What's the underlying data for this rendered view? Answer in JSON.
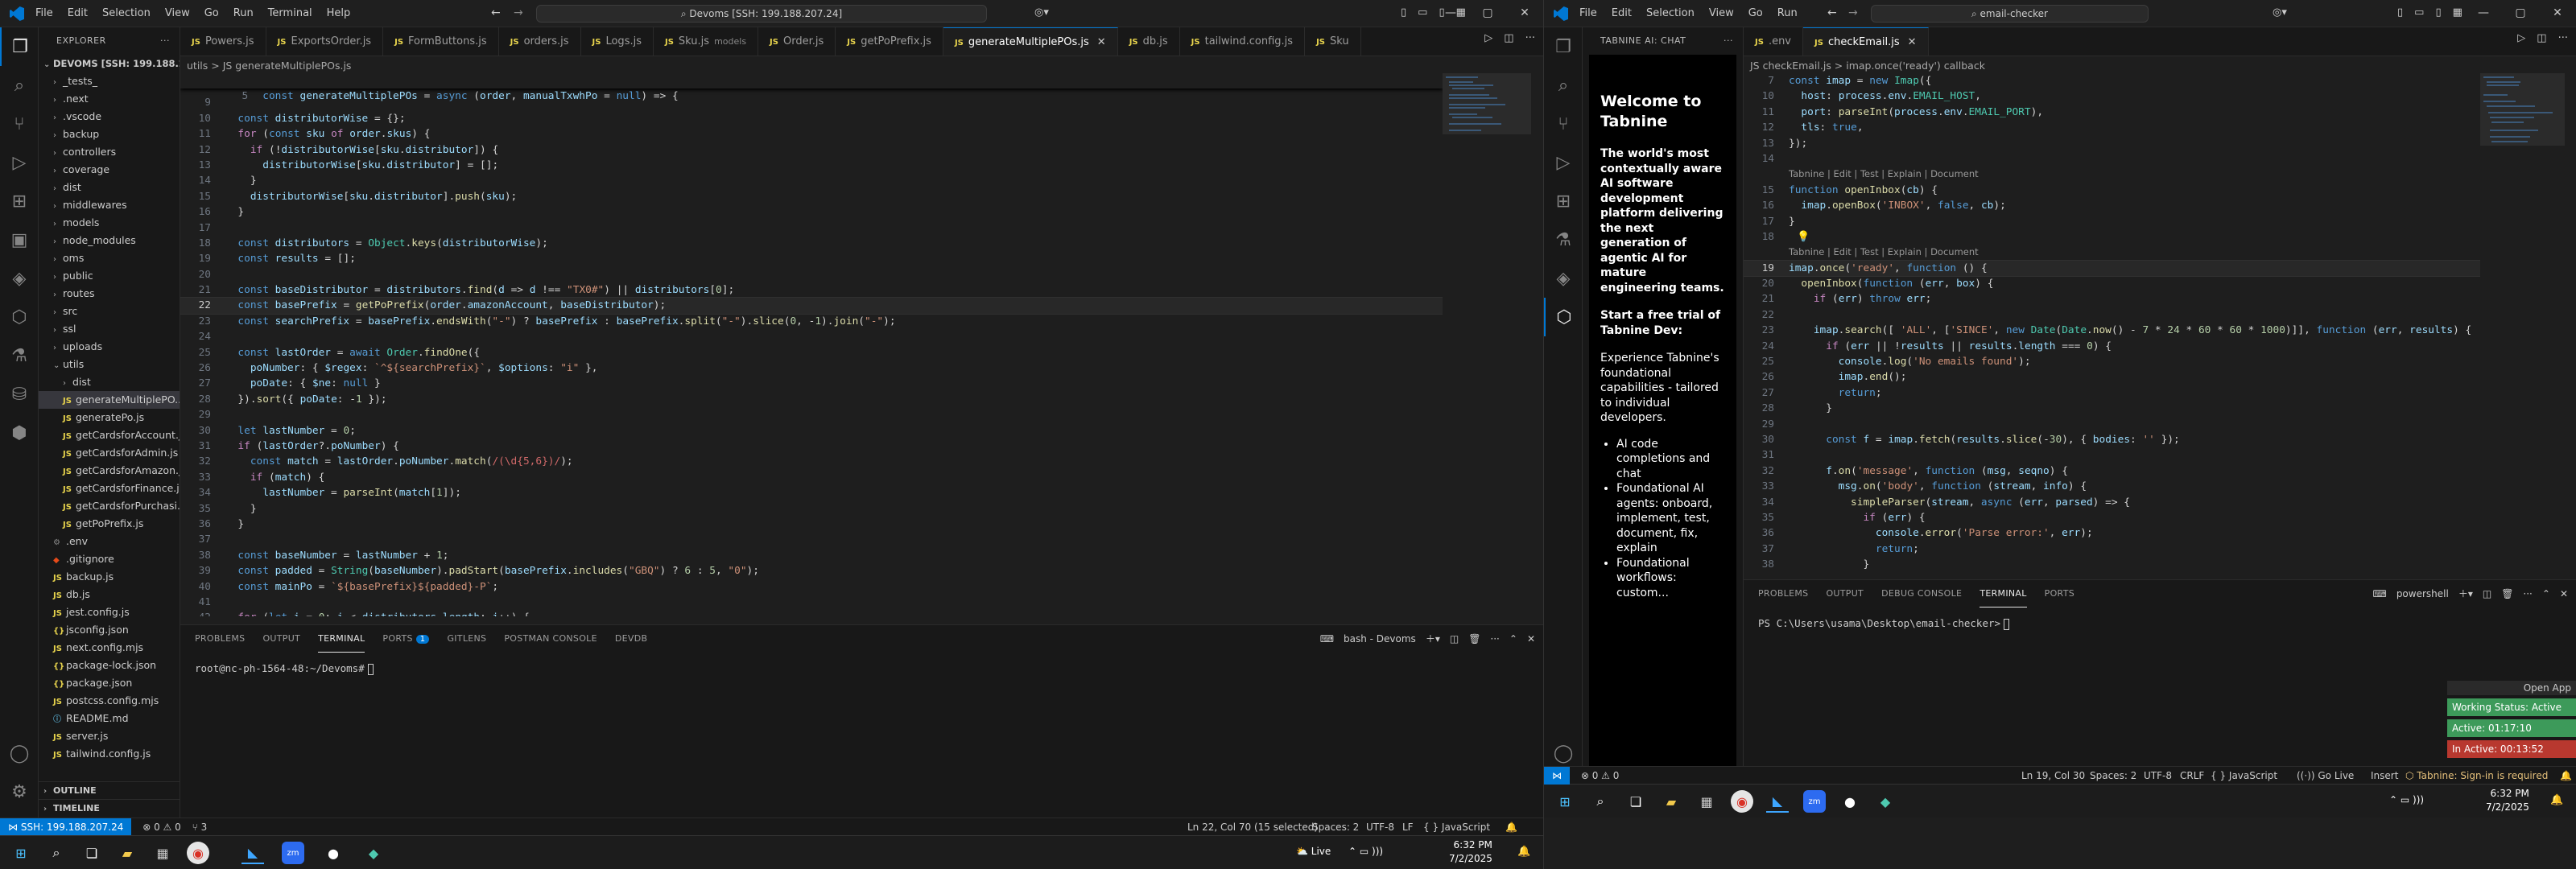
{
  "left_window": {
    "menu": [
      "File",
      "Edit",
      "Selection",
      "View",
      "Go",
      "Run",
      "Terminal",
      "Help"
    ],
    "search": "Devoms [SSH: 199.188.207.24]",
    "explorer_title": "EXPLORER",
    "root_folder": "DEVOMS [SSH: 199.188.20...",
    "tree": [
      {
        "label": "_tests_",
        "kind": "folder",
        "depth": 1
      },
      {
        "label": ".next",
        "kind": "folder",
        "depth": 1
      },
      {
        "label": ".vscode",
        "kind": "folder",
        "depth": 1
      },
      {
        "label": "backup",
        "kind": "folder",
        "depth": 1
      },
      {
        "label": "controllers",
        "kind": "folder",
        "depth": 1
      },
      {
        "label": "coverage",
        "kind": "folder",
        "depth": 1
      },
      {
        "label": "dist",
        "kind": "folder",
        "depth": 1
      },
      {
        "label": "middlewares",
        "kind": "folder",
        "depth": 1
      },
      {
        "label": "models",
        "kind": "folder",
        "depth": 1
      },
      {
        "label": "node_modules",
        "kind": "folder",
        "depth": 1
      },
      {
        "label": "oms",
        "kind": "folder",
        "depth": 1
      },
      {
        "label": "public",
        "kind": "folder",
        "depth": 1
      },
      {
        "label": "routes",
        "kind": "folder",
        "depth": 1
      },
      {
        "label": "src",
        "kind": "folder",
        "depth": 1
      },
      {
        "label": "ssl",
        "kind": "folder",
        "depth": 1
      },
      {
        "label": "uploads",
        "kind": "folder",
        "depth": 1
      },
      {
        "label": "utils",
        "kind": "folder-open",
        "depth": 1
      },
      {
        "label": "dist",
        "kind": "folder",
        "depth": 2
      },
      {
        "label": "generateMultiplePO...",
        "kind": "js",
        "depth": 2,
        "selected": true
      },
      {
        "label": "generatePo.js",
        "kind": "js",
        "depth": 2
      },
      {
        "label": "getCardsforAccount.js",
        "kind": "js",
        "depth": 2
      },
      {
        "label": "getCardsforAdmin.js",
        "kind": "js",
        "depth": 2
      },
      {
        "label": "getCardsforAmazon.js",
        "kind": "js",
        "depth": 2
      },
      {
        "label": "getCardsforFinance.js",
        "kind": "js",
        "depth": 2
      },
      {
        "label": "getCardsforPurchasi...",
        "kind": "js",
        "depth": 2
      },
      {
        "label": "getPoPrefix.js",
        "kind": "js",
        "depth": 2
      },
      {
        "label": ".env",
        "kind": "env",
        "depth": 1
      },
      {
        "label": ".gitignore",
        "kind": "git",
        "depth": 1
      },
      {
        "label": "backup.js",
        "kind": "js",
        "depth": 1
      },
      {
        "label": "db.js",
        "kind": "js",
        "depth": 1
      },
      {
        "label": "jest.config.js",
        "kind": "js",
        "depth": 1
      },
      {
        "label": "jsconfig.json",
        "kind": "json",
        "depth": 1
      },
      {
        "label": "next.config.mjs",
        "kind": "js",
        "depth": 1
      },
      {
        "label": "package-lock.json",
        "kind": "json",
        "depth": 1
      },
      {
        "label": "package.json",
        "kind": "json",
        "depth": 1
      },
      {
        "label": "postcss.config.mjs",
        "kind": "js",
        "depth": 1
      },
      {
        "label": "README.md",
        "kind": "md",
        "depth": 1
      },
      {
        "label": "server.js",
        "kind": "js",
        "depth": 1
      },
      {
        "label": "tailwind.config.js",
        "kind": "js",
        "depth": 1
      }
    ],
    "outline": "OUTLINE",
    "timeline": "TIMELINE",
    "tabs": [
      {
        "label": "Powers.js"
      },
      {
        "label": "ExportsOrder.js"
      },
      {
        "label": "FormButtons.js"
      },
      {
        "label": "orders.js"
      },
      {
        "label": "Logs.js"
      },
      {
        "label": "Sku.js",
        "sub": "models"
      },
      {
        "label": "Order.js"
      },
      {
        "label": "getPoPrefix.js"
      },
      {
        "label": "generateMultiplePOs.js",
        "active": true
      },
      {
        "label": "db.js"
      },
      {
        "label": "tailwind.config.js"
      },
      {
        "label": "Sku"
      }
    ],
    "breadcrumb": "utils > JS generateMultiplePOs.js",
    "sticky_line": {
      "num": "5",
      "code": "const generateMultiplePOs = async (order, manualTxwhPo = null) => {"
    },
    "code": [
      {
        "num": "9",
        "code": ""
      },
      {
        "num": "10",
        "code": "  const distributorWise = {};"
      },
      {
        "num": "11",
        "code": "  for (const sku of order.skus) {"
      },
      {
        "num": "12",
        "code": "    if (!distributorWise[sku.distributor]) {"
      },
      {
        "num": "13",
        "code": "      distributorWise[sku.distributor] = [];"
      },
      {
        "num": "14",
        "code": "    }"
      },
      {
        "num": "15",
        "code": "    distributorWise[sku.distributor].push(sku);"
      },
      {
        "num": "16",
        "code": "  }"
      },
      {
        "num": "17",
        "code": ""
      },
      {
        "num": "18",
        "code": "  const distributors = Object.keys(distributorWise);"
      },
      {
        "num": "19",
        "code": "  const results = [];"
      },
      {
        "num": "20",
        "code": ""
      },
      {
        "num": "21",
        "code": "  const baseDistributor = distributors.find(d => d !== \"TX0#\") || distributors[0];"
      },
      {
        "num": "22",
        "code": "  const basePrefix = getPoPrefix(order.amazonAccount, baseDistributor);",
        "current": true
      },
      {
        "num": "23",
        "code": "  const searchPrefix = basePrefix.endsWith(\"-\") ? basePrefix : basePrefix.split(\"-\").slice(0, -1).join(\"-\");"
      },
      {
        "num": "24",
        "code": ""
      },
      {
        "num": "25",
        "code": "  const lastOrder = await Order.findOne({"
      },
      {
        "num": "26",
        "code": "    poNumber: { $regex: `^${searchPrefix}`, $options: \"i\" },"
      },
      {
        "num": "27",
        "code": "    poDate: { $ne: null }"
      },
      {
        "num": "28",
        "code": "  }).sort({ poDate: -1 });"
      },
      {
        "num": "29",
        "code": ""
      },
      {
        "num": "30",
        "code": "  let lastNumber = 0;"
      },
      {
        "num": "31",
        "code": "  if (lastOrder?.poNumber) {"
      },
      {
        "num": "32",
        "code": "    const match = lastOrder.poNumber.match(/(\\d{5,6})/);"
      },
      {
        "num": "33",
        "code": "    if (match) {"
      },
      {
        "num": "34",
        "code": "      lastNumber = parseInt(match[1]);"
      },
      {
        "num": "35",
        "code": "    }"
      },
      {
        "num": "36",
        "code": "  }"
      },
      {
        "num": "37",
        "code": ""
      },
      {
        "num": "38",
        "code": "  const baseNumber = lastNumber + 1;"
      },
      {
        "num": "39",
        "code": "  const padded = String(baseNumber).padStart(basePrefix.includes(\"GBQ\") ? 6 : 5, \"0\");"
      },
      {
        "num": "40",
        "code": "  const mainPo = `${basePrefix}${padded}-P`;"
      },
      {
        "num": "41",
        "code": ""
      },
      {
        "num": "42",
        "code": "  for (let i = 0; i < distributors.length; i++) {"
      }
    ],
    "panel_tabs": [
      "PROBLEMS",
      "OUTPUT",
      "TERMINAL",
      "PORTS",
      "GITLENS",
      "POSTMAN CONSOLE",
      "DEVDB"
    ],
    "ports_badge": "1",
    "terminal_name": "bash - Devoms",
    "terminal_prompt": "root@nc-ph-1564-48:~/Devoms#",
    "status": {
      "remote": "SSH: 199.188.207.24",
      "errors": "0",
      "warnings": "0",
      "sync": "3",
      "position": "Ln 22, Col 70 (15 selected)",
      "spaces": "Spaces: 2",
      "encoding": "UTF-8",
      "eol": "LF",
      "language": "JavaScript"
    },
    "taskbar": {
      "weather": "Live",
      "time": "6:32 PM",
      "date": "7/2/2025"
    }
  },
  "right_window": {
    "menu": [
      "File",
      "Edit",
      "Selection",
      "View",
      "Go",
      "Run"
    ],
    "search": "email-checker",
    "chat_title": "TABNINE AI: CHAT",
    "tabnine": {
      "heading": "Welcome to Tabnine",
      "intro": "The world's most contextually aware AI software development platform delivering the next generation of agentic AI for mature engineering teams.",
      "cta": "Start a free trial of Tabnine Dev:",
      "body": "Experience Tabnine's foundational capabilities - tailored to individual developers.",
      "bullets": [
        "AI code completions and chat",
        "Foundational AI agents: onboard, implement, test, document, fix, explain",
        "Foundational workflows: custom..."
      ]
    },
    "tabs": [
      {
        "label": ".env"
      },
      {
        "label": "checkEmail.js",
        "active": true
      }
    ],
    "breadcrumb": "JS checkEmail.js > imap.once('ready') callback",
    "code": [
      {
        "num": "7",
        "code": "const imap = new Imap({"
      },
      {
        "num": "10",
        "code": "  host: process.env.EMAIL_HOST,"
      },
      {
        "num": "11",
        "code": "  port: parseInt(process.env.EMAIL_PORT),"
      },
      {
        "num": "12",
        "code": "  tls: true,"
      },
      {
        "num": "13",
        "code": "});"
      },
      {
        "num": "14",
        "code": ""
      },
      {
        "lens": "Tabnine | Edit | Test | Explain | Document"
      },
      {
        "num": "15",
        "code": "function openInbox(cb) {"
      },
      {
        "num": "16",
        "code": "  imap.openBox('INBOX', false, cb);"
      },
      {
        "num": "17",
        "code": "}"
      },
      {
        "num": "18",
        "code": ""
      },
      {
        "lens": "Tabnine | Edit | Test | Explain | Document"
      },
      {
        "num": "19",
        "code": "imap.once('ready', function () {",
        "current": true
      },
      {
        "num": "20",
        "code": "  openInbox(function (err, box) {"
      },
      {
        "num": "21",
        "code": "    if (err) throw err;"
      },
      {
        "num": "22",
        "code": ""
      },
      {
        "num": "23",
        "code": "    imap.search([ 'ALL', ['SINCE', new Date(Date.now() - 7 * 24 * 60 * 60 * 1000)]], function (err, results) {"
      },
      {
        "num": "24",
        "code": "      if (err || !results || results.length === 0) {"
      },
      {
        "num": "25",
        "code": "        console.log('No emails found');"
      },
      {
        "num": "26",
        "code": "        imap.end();"
      },
      {
        "num": "27",
        "code": "        return;"
      },
      {
        "num": "28",
        "code": "      }"
      },
      {
        "num": "29",
        "code": ""
      },
      {
        "num": "30",
        "code": "      const f = imap.fetch(results.slice(-30), { bodies: '' });"
      },
      {
        "num": "31",
        "code": ""
      },
      {
        "num": "32",
        "code": "      f.on('message', function (msg, seqno) {"
      },
      {
        "num": "33",
        "code": "        msg.on('body', function (stream, info) {"
      },
      {
        "num": "34",
        "code": "          simpleParser(stream, async (err, parsed) => {"
      },
      {
        "num": "35",
        "code": "            if (err) {"
      },
      {
        "num": "36",
        "code": "              console.error('Parse error:', err);"
      },
      {
        "num": "37",
        "code": "              return;"
      },
      {
        "num": "38",
        "code": "            }"
      }
    ],
    "panel_tabs": [
      "PROBLEMS",
      "OUTPUT",
      "DEBUG CONSOLE",
      "TERMINAL",
      "PORTS"
    ],
    "terminal_name": "powershell",
    "terminal_prompt": "PS C:\\Users\\usama\\Desktop\\email-checker>",
    "widget": {
      "open_app": "Open App",
      "working": "Working Status: Active",
      "active": "Active: 01:17:10",
      "inactive": "In Active: 00:13:52"
    },
    "status": {
      "errors": "0",
      "warnings": "0",
      "position": "Ln 19, Col 30",
      "spaces": "Spaces: 2",
      "encoding": "UTF-8",
      "eol": "CRLF",
      "language": "JavaScript",
      "golive": "Go Live",
      "insert": "Insert",
      "tabnine": "Tabnine: Sign-in is required"
    },
    "taskbar": {
      "time": "6:32 PM",
      "date": "7/2/2025"
    }
  },
  "colors": {
    "accent": "#0078d4",
    "active_green": "#3d9a5a",
    "inactive_red": "#b8382f",
    "tabnine_yellow": "#e5c07b"
  }
}
